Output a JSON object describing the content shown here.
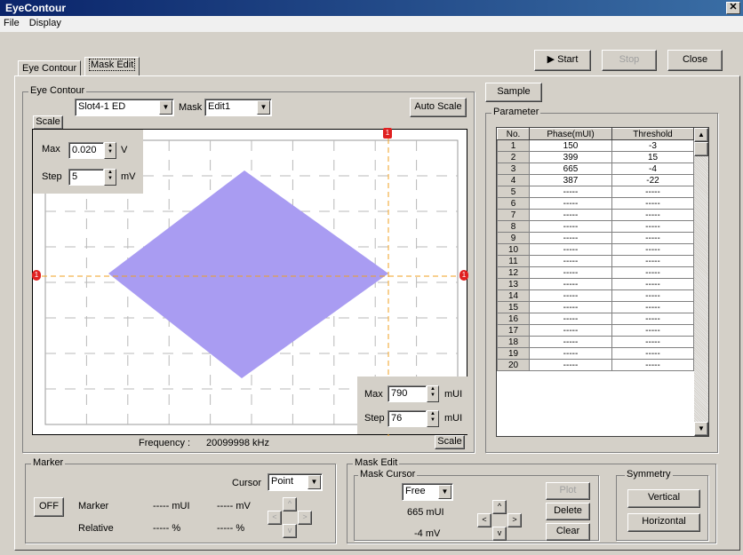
{
  "window": {
    "title": "EyeContour",
    "close_label": "✕"
  },
  "menu": [
    "File",
    "Display"
  ],
  "tabs": [
    "Eye Contour",
    "Mask Edit"
  ],
  "toolbar": {
    "start": "Start",
    "stop": "Stop",
    "close": "Close"
  },
  "eye_contour": {
    "group_title": "Eye Contour",
    "slot": "Slot4-1 ED",
    "mask_label": "Mask",
    "mask_value": "Edit1",
    "auto_scale": "Auto Scale",
    "scale_tab": "Scale",
    "v_scale": {
      "max_label": "Max",
      "max_value": "0.020",
      "max_unit": "V",
      "step_label": "Step",
      "step_value": "5",
      "step_unit": "mV"
    },
    "h_scale": {
      "max_label": "Max",
      "max_value": "790",
      "max_unit": "mUI",
      "step_label": "Step",
      "step_value": "76",
      "step_unit": "mUI"
    },
    "frequency_label": "Frequency :",
    "frequency_value": "20099998 kHz",
    "scale_tab_bottom": "Scale",
    "cursor_marker": "1",
    "mask_color": "#a99cf2"
  },
  "sample": "Sample",
  "parameter": {
    "title": "Parameter",
    "headers": [
      "No.",
      "Phase(mUI)",
      "Threshold"
    ],
    "rows": [
      [
        "1",
        "150",
        "-3"
      ],
      [
        "2",
        "399",
        "15"
      ],
      [
        "3",
        "665",
        "-4"
      ],
      [
        "4",
        "387",
        "-22"
      ],
      [
        "5",
        "-----",
        "-----"
      ],
      [
        "6",
        "-----",
        "-----"
      ],
      [
        "7",
        "-----",
        "-----"
      ],
      [
        "8",
        "-----",
        "-----"
      ],
      [
        "9",
        "-----",
        "-----"
      ],
      [
        "10",
        "-----",
        "-----"
      ],
      [
        "11",
        "-----",
        "-----"
      ],
      [
        "12",
        "-----",
        "-----"
      ],
      [
        "13",
        "-----",
        "-----"
      ],
      [
        "14",
        "-----",
        "-----"
      ],
      [
        "15",
        "-----",
        "-----"
      ],
      [
        "16",
        "-----",
        "-----"
      ],
      [
        "17",
        "-----",
        "-----"
      ],
      [
        "18",
        "-----",
        "-----"
      ],
      [
        "19",
        "-----",
        "-----"
      ],
      [
        "20",
        "-----",
        "-----"
      ]
    ]
  },
  "marker": {
    "title": "Marker",
    "off": "OFF",
    "cursor_label": "Cursor",
    "cursor_value": "Point",
    "marker_label": "Marker",
    "marker_mui": "----- mUI",
    "marker_mv": "----- mV",
    "relative_label": "Relative",
    "relative_pct1": "----- %",
    "relative_pct2": "----- %"
  },
  "mask_edit": {
    "title": "Mask Edit",
    "cursor_title": "Mask Cursor",
    "cursor_mode": "Free",
    "mui": "665  mUI",
    "mv": "-4  mV",
    "plot": "Plot",
    "delete": "Delete",
    "clear": "Clear",
    "symmetry": "Symmetry",
    "vertical": "Vertical",
    "horizontal": "Horizontal"
  }
}
